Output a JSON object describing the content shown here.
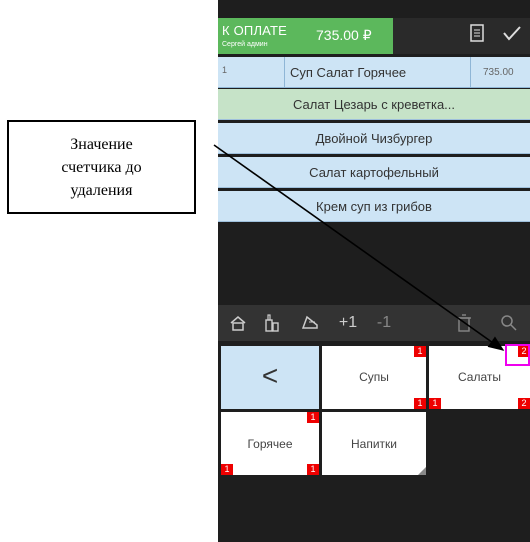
{
  "callout": {
    "line1": "Значение",
    "line2": "счетчика до",
    "line3": "удаления"
  },
  "header": {
    "pay_title": "К ОПЛАТЕ",
    "user": "Сергей админ",
    "amount": "735.00 ₽",
    "receipt_icon": "receipt-icon",
    "check_icon": "checkmark-icon"
  },
  "order": {
    "first_row": {
      "qty": "1",
      "name": "Суп Салат Горячее",
      "price": "735.00"
    },
    "menu_items": [
      {
        "label": "Салат Цезарь с креветка..."
      },
      {
        "label": "Двойной Чизбургер"
      },
      {
        "label": "Салат картофельный"
      },
      {
        "label": "Крем суп из грибов"
      }
    ]
  },
  "toolbar": {
    "plus_label": "+1",
    "minus_label": "-1",
    "icons": [
      "home-icon",
      "bottle-icon",
      "dish-icon",
      "trash-icon",
      "search-icon"
    ]
  },
  "tiles": {
    "back_symbol": "<",
    "soups": {
      "label": "Супы",
      "badge_top": "1",
      "badge_bottom": "1"
    },
    "salads": {
      "label": "Салаты",
      "badge_top": "2",
      "badge_bottom_left": "1",
      "badge_bottom_right": "2"
    },
    "hot": {
      "label": "Горячее",
      "badge_top": "1",
      "badge_bottom_left": "1",
      "badge_bottom_right": "1"
    },
    "drinks": {
      "label": "Напитки"
    }
  },
  "colors": {
    "pay_green": "#5cb85c",
    "row_blue": "#cde4f5",
    "row_selected": "#c6e3c8",
    "badge_red": "#e00000",
    "highlight_magenta": "#e000e0"
  }
}
